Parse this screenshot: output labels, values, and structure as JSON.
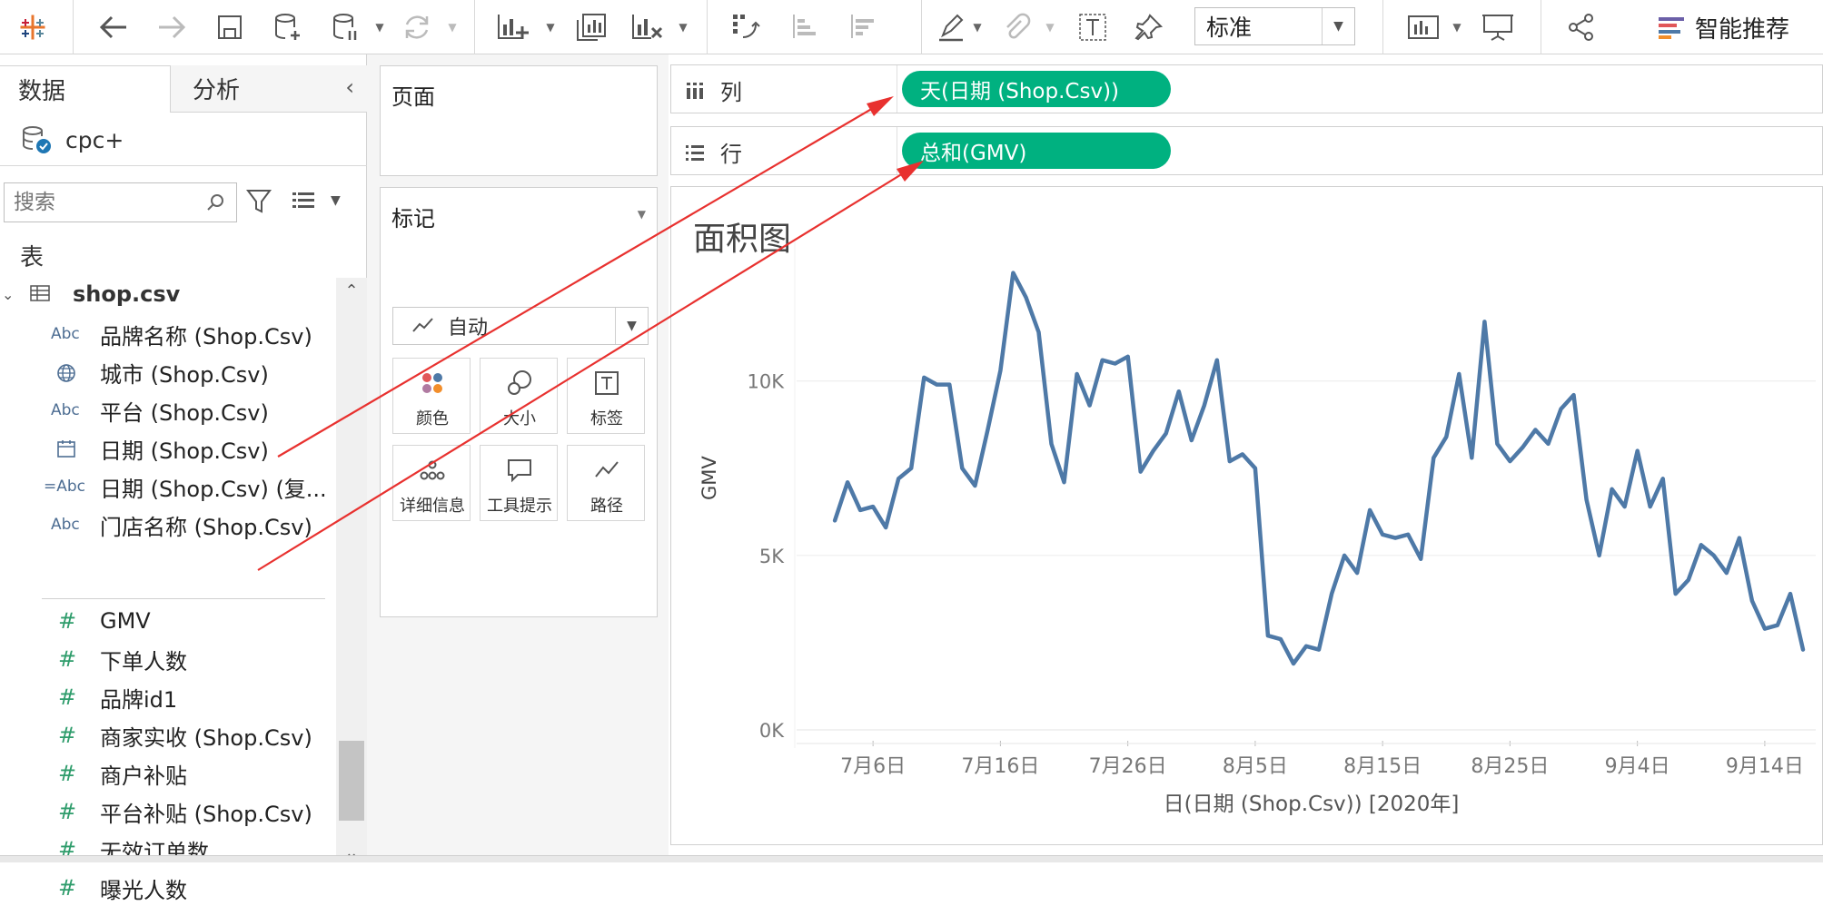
{
  "toolbar": {
    "zoom_value": "标准",
    "smart_label": "智能推荐"
  },
  "left_pane": {
    "tab_data": "数据",
    "tab_analysis": "分析",
    "datasource": "cpc+",
    "search_placeholder": "搜索",
    "section_title": "表",
    "table_name": "shop.csv",
    "dimensions": [
      {
        "type": "Abc",
        "name": "品牌名称 (Shop.Csv)"
      },
      {
        "type": "geo",
        "name": "城市 (Shop.Csv)"
      },
      {
        "type": "Abc",
        "name": "平台 (Shop.Csv)"
      },
      {
        "type": "date",
        "name": "日期 (Shop.Csv)"
      },
      {
        "type": "=Abc",
        "name": "日期 (Shop.Csv) (复..."
      },
      {
        "type": "Abc",
        "name": "门店名称 (Shop.Csv)"
      }
    ],
    "measures": [
      {
        "name": "GMV"
      },
      {
        "name": "下单人数"
      },
      {
        "name": "品牌id1"
      },
      {
        "name": "商家实收 (Shop.Csv)"
      },
      {
        "name": "商户补贴"
      },
      {
        "name": "平台补贴 (Shop.Csv)"
      },
      {
        "name": "无效订单数"
      },
      {
        "name": "曝光人数"
      }
    ]
  },
  "mid_pane": {
    "pages_title": "页面",
    "marks_title": "标记",
    "marks_type": "自动",
    "mark_buttons": [
      "颜色",
      "大小",
      "标签",
      "详细信息",
      "工具提示",
      "路径"
    ]
  },
  "shelves": {
    "columns_label": "列",
    "columns_pill": "天(日期 (Shop.Csv))",
    "rows_label": "行",
    "rows_pill": "总和(GMV)"
  },
  "chart_data": {
    "type": "line",
    "title": "面积图",
    "ylabel": "GMV",
    "xlabel": "日(日期 (Shop.Csv)) [2020年]",
    "ylim": [
      0,
      14000
    ],
    "y_ticks": [
      {
        "value": 0,
        "label": "0K"
      },
      {
        "value": 5000,
        "label": "5K"
      },
      {
        "value": 10000,
        "label": "10K"
      }
    ],
    "x_ticks": [
      {
        "day": 7,
        "label": "7月6日"
      },
      {
        "day": 17,
        "label": "7月16日"
      },
      {
        "day": 27,
        "label": "7月26日"
      },
      {
        "day": 37,
        "label": "8月5日"
      },
      {
        "day": 47,
        "label": "8月15日"
      },
      {
        "day": 57,
        "label": "8月25日"
      },
      {
        "day": 67,
        "label": "9月4日"
      },
      {
        "day": 77,
        "label": "9月14日"
      }
    ],
    "line_color": "#4e79a7",
    "series": [
      {
        "values": [
          6000,
          7100,
          6300,
          6400,
          5800,
          7200,
          7500,
          10100,
          9900,
          9900,
          7500,
          7000,
          8600,
          10300,
          13100,
          12400,
          11400,
          8200,
          7100,
          10200,
          9300,
          10600,
          10500,
          10700,
          7400,
          8000,
          8500,
          9700,
          8300,
          9300,
          10600,
          7700,
          7900,
          7500,
          2700,
          2600,
          1900,
          2400,
          2300,
          3900,
          5000,
          4500,
          6300,
          5600,
          5500,
          5600,
          4900,
          7800,
          8400,
          10200,
          7800,
          11700,
          8200,
          7700,
          8100,
          8600,
          8200,
          9200,
          9600,
          6600,
          5000,
          6900,
          6400,
          8000,
          6400,
          7200,
          3900,
          4300,
          5300,
          5000,
          4500,
          5500,
          3700,
          2900,
          3000,
          3900,
          2300
        ]
      }
    ],
    "x_range": [
      1,
      81
    ]
  }
}
